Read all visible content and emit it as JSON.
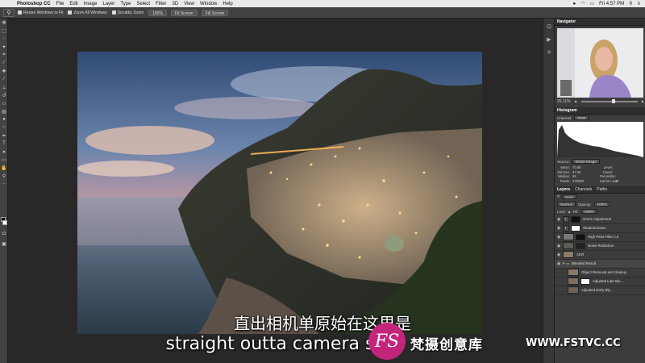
{
  "menubar": {
    "app_name": "Photoshop CC",
    "items": [
      "File",
      "Edit",
      "Image",
      "Layer",
      "Type",
      "Select",
      "Filter",
      "3D",
      "View",
      "Window",
      "Help"
    ],
    "status_icons": [
      "notification-icon",
      "wifi-icon",
      "battery-icon"
    ],
    "clock": "Fri 4:57 PM"
  },
  "options_bar": {
    "checkbox_resize": "Resize Windows to Fit",
    "checkbox_zoom_all": "Zoom All Windows",
    "checkbox_scrubby": "Scrubby Zoom",
    "zoom_value": "100%",
    "btn_fit_screen": "Fit Screen",
    "btn_fill_screen": "Fill Screen"
  },
  "panels": {
    "navigator": {
      "tab": "Navigator",
      "zoom": "26.11%"
    },
    "histogram": {
      "tab": "Histogram",
      "channel_label": "Channel:",
      "channel_value": "RGB",
      "source_label": "Source:",
      "source_value": "Entire Image",
      "stats": [
        {
          "k": "Mean:",
          "v": "70.60"
        },
        {
          "k": "Level:",
          "v": ""
        },
        {
          "k": "Std Dev:",
          "v": "47.06"
        },
        {
          "k": "Count:",
          "v": ""
        },
        {
          "k": "Median:",
          "v": "65"
        },
        {
          "k": "Percentile:",
          "v": ""
        },
        {
          "k": "Pixels:",
          "v": "375000"
        },
        {
          "k": "Cache Level:",
          "v": "4"
        }
      ]
    },
    "layers": {
      "tabs": [
        "Layers",
        "Channels",
        "Paths"
      ],
      "filter_kind": "Kind",
      "blend_mode": "Normal",
      "opacity_label": "Opacity:",
      "opacity_value": "100%",
      "lock_label": "Lock:",
      "fill_label": "Fill:",
      "fill_value": "100%",
      "items": [
        "Green Adjustment",
        "Shadow boost",
        "High Pass Filter 2.5",
        "Noise Reduction",
        "ACR",
        "Blended Result",
        "Object Removal and cleanup",
        "Adjusted Late Blu...",
        "Adjusted Early Bly..."
      ]
    }
  },
  "subtitles": {
    "chinese": "直出相机单原始在这里是",
    "english": "straight outta camera sin"
  },
  "watermark": {
    "logo_text": "FS",
    "brand_cn": "梵摄创意库",
    "url": "WWW.FSTVC.CC"
  }
}
